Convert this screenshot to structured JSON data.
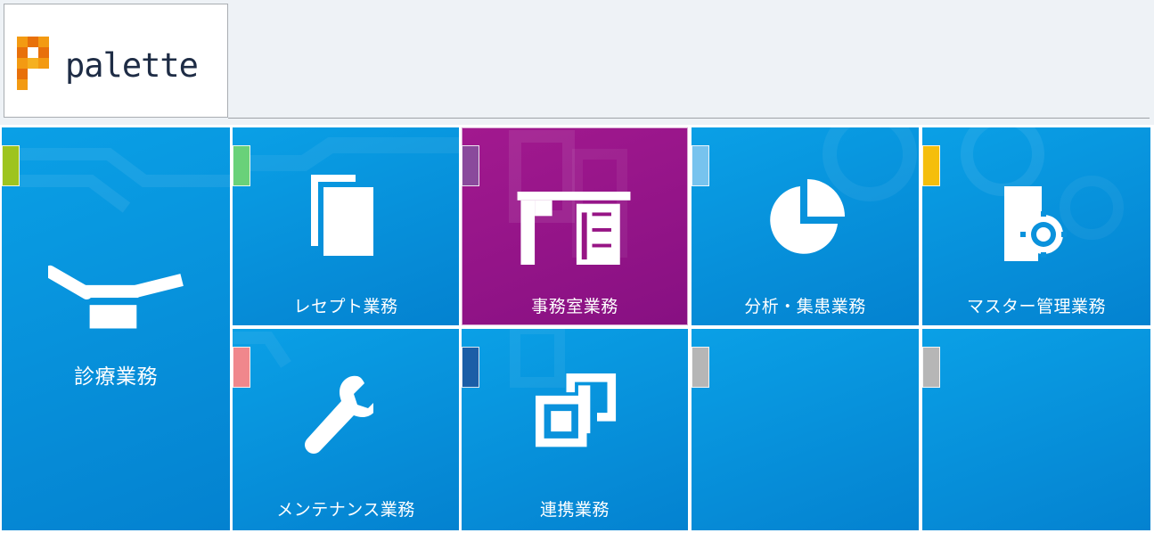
{
  "header": {
    "logo_text": "palette"
  },
  "tiles": [
    {
      "label": "診療業務",
      "tag_color": "#9ec41e",
      "icon": "dental-chair-icon"
    },
    {
      "label": "レセプト業務",
      "tag_color": "#69d179",
      "icon": "documents-icon"
    },
    {
      "label": "事務室業務",
      "tag_color": "#8a4a9c",
      "icon": "office-desk-icon",
      "active": true
    },
    {
      "label": "分析・集患業務",
      "tag_color": "#77c3ee",
      "icon": "pie-chart-icon"
    },
    {
      "label": "マスター管理業務",
      "tag_color": "#f5be0c",
      "icon": "document-gear-icon"
    },
    {
      "label": "メンテナンス業務",
      "tag_color": "#f0878c",
      "icon": "wrench-icon"
    },
    {
      "label": "連携業務",
      "tag_color": "#1b5ea7",
      "icon": "linked-windows-icon"
    },
    {
      "label": "",
      "tag_color": "#b6b6b6",
      "icon": ""
    },
    {
      "label": "",
      "tag_color": "#b6b6b6",
      "icon": ""
    }
  ],
  "colors": {
    "tile_blue": "#0a92dc",
    "tile_active": "#971585",
    "header_bg": "#eef2f6"
  }
}
